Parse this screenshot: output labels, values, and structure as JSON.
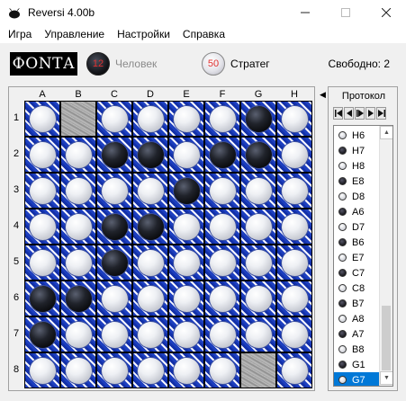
{
  "window": {
    "title": "Reversi 4.00b",
    "minimize_icon": "minimize-icon",
    "maximize_icon": "maximize-icon",
    "close_icon": "close-icon"
  },
  "menu": [
    "Игра",
    "Управление",
    "Настройки",
    "Справка"
  ],
  "toolbar": {
    "logo": "ФОNТА",
    "player1": {
      "count": "12",
      "name": "Человек",
      "color": "black",
      "active": false
    },
    "player2": {
      "count": "50",
      "name": "Стратег",
      "color": "white",
      "active": true
    },
    "free_label": "Свободно:",
    "free_count": "2"
  },
  "board": {
    "columns": [
      "A",
      "B",
      "C",
      "D",
      "E",
      "F",
      "G",
      "H"
    ],
    "rows": [
      "1",
      "2",
      "3",
      "4",
      "5",
      "6",
      "7",
      "8"
    ],
    "cells": [
      [
        "W",
        ".",
        "W",
        "W",
        "W",
        "W",
        "B",
        "W"
      ],
      [
        "W",
        "W",
        "B",
        "B",
        "W",
        "B",
        "B",
        "W"
      ],
      [
        "W",
        "W",
        "W",
        "W",
        "B",
        "W",
        "W",
        "W"
      ],
      [
        "W",
        "W",
        "B",
        "B",
        "W",
        "W",
        "W",
        "W"
      ],
      [
        "W",
        "W",
        "B",
        "W",
        "W",
        "W",
        "W",
        "W"
      ],
      [
        "B",
        "B",
        "W",
        "W",
        "W",
        "W",
        "W",
        "W"
      ],
      [
        "B",
        "W",
        "W",
        "W",
        "W",
        "W",
        "W",
        "W"
      ],
      [
        "W",
        "W",
        "W",
        "W",
        "W",
        "W",
        ".",
        "W"
      ]
    ]
  },
  "protocol": {
    "title": "Протокол",
    "nav": [
      "|◀",
      "◀",
      "|▶",
      "▶",
      "▶|"
    ],
    "moves": [
      {
        "label": "H6",
        "color": "white"
      },
      {
        "label": "H7",
        "color": "black"
      },
      {
        "label": "H8",
        "color": "white"
      },
      {
        "label": "E8",
        "color": "black"
      },
      {
        "label": "D8",
        "color": "white"
      },
      {
        "label": "A6",
        "color": "black"
      },
      {
        "label": "D7",
        "color": "white"
      },
      {
        "label": "B6",
        "color": "black"
      },
      {
        "label": "E7",
        "color": "white"
      },
      {
        "label": "C7",
        "color": "black"
      },
      {
        "label": "C8",
        "color": "white"
      },
      {
        "label": "B7",
        "color": "black"
      },
      {
        "label": "A8",
        "color": "white"
      },
      {
        "label": "A7",
        "color": "black"
      },
      {
        "label": "B8",
        "color": "white"
      },
      {
        "label": "G1",
        "color": "black"
      },
      {
        "label": "G7",
        "color": "white",
        "selected": true
      }
    ]
  }
}
